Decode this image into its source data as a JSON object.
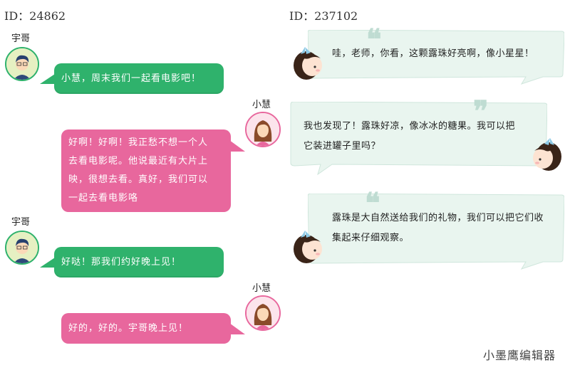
{
  "left_panel": {
    "id_label": "ID：24862",
    "messages": [
      {
        "speaker": "宇哥",
        "text": "小慧，周末我们一起看电影吧！"
      },
      {
        "speaker": "小慧",
        "lines": [
          "好啊！好啊！我正愁不想一个人",
          "去看电影呢。他说最近有大片上",
          "映，很想去看。真好，我们可以",
          "一起去看电影咯"
        ]
      },
      {
        "speaker": "宇哥",
        "text": "好哒！那我们约好晚上见！"
      },
      {
        "speaker": "小慧",
        "text": "好的，好的。宇哥晚上见！"
      }
    ]
  },
  "right_panel": {
    "id_label": "ID：237102",
    "cards": [
      {
        "lines": [
          "哇，老师，你看，这颗露珠好亮啊，像小星星！"
        ]
      },
      {
        "lines": [
          "我也发现了！露珠好凉，像冰冰的糖果。我可以把",
          "它装进罐子里吗？"
        ]
      },
      {
        "lines": [
          "露珠是大自然送给我们的礼物，我们可以把它们收",
          "集起来仔细观察。"
        ]
      }
    ]
  },
  "footer": {
    "editor": "小墨鹰编辑器"
  },
  "colors": {
    "green": "#2fb26c",
    "pink": "#e8679d",
    "card_bg": "#e9f5ef",
    "quote": "#bfdcd2"
  },
  "icons": [
    "boy-avatar-icon",
    "girl-avatar-icon",
    "cartoon-girl-icon",
    "quote-icon"
  ]
}
